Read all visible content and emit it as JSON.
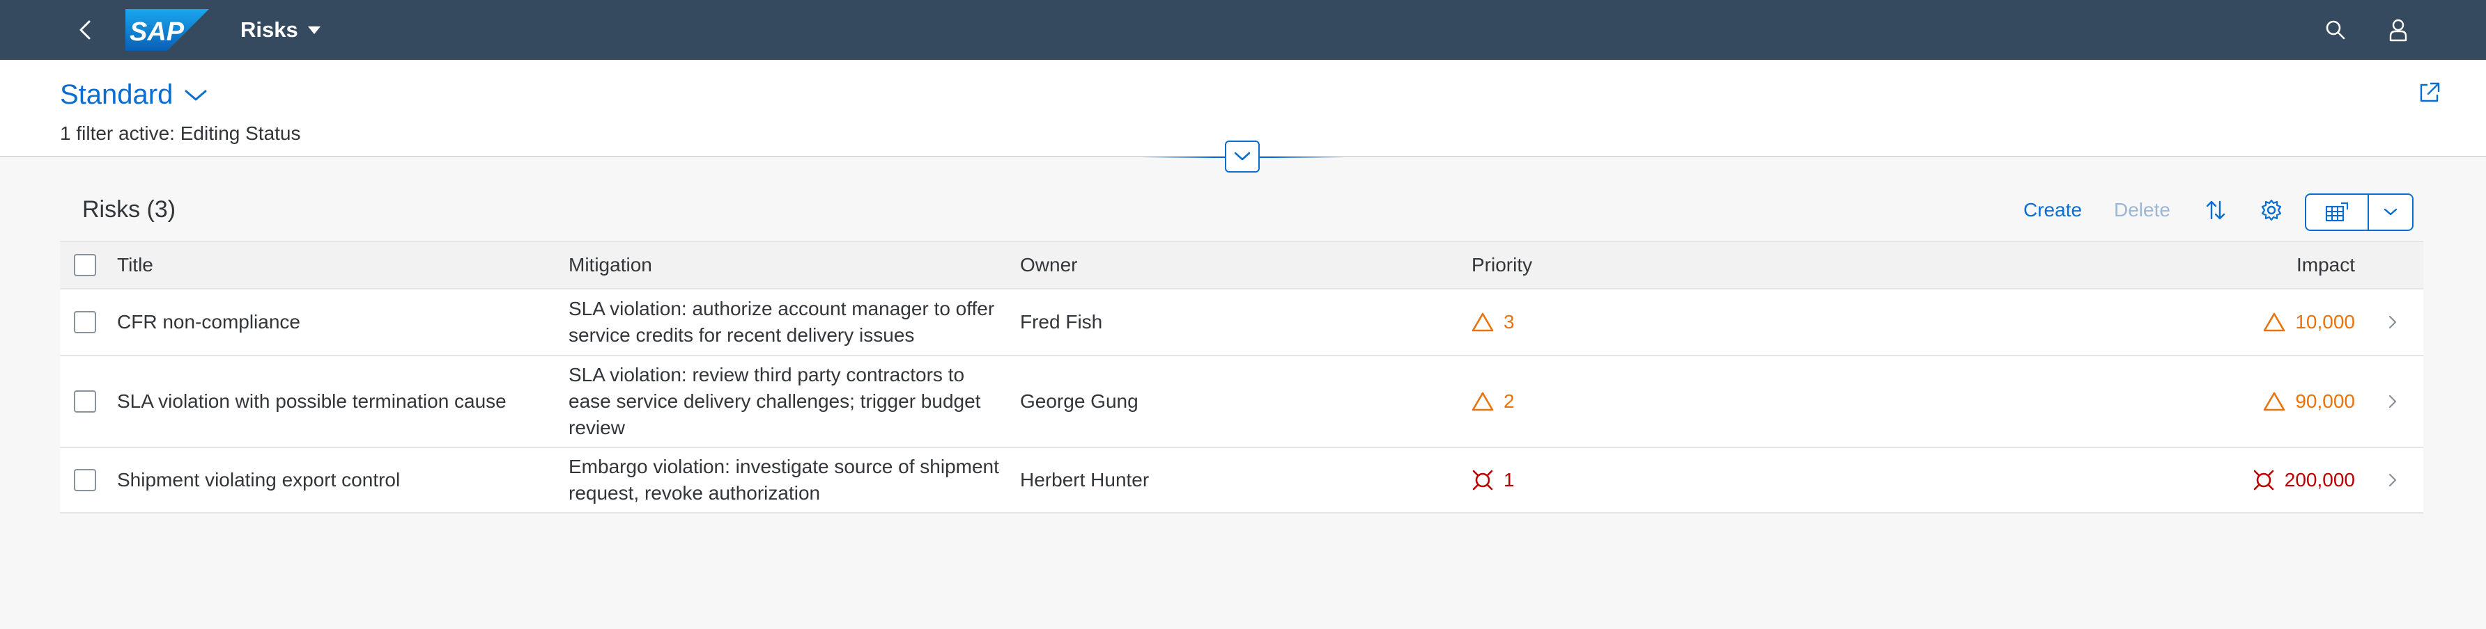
{
  "shell": {
    "logo_text": "SAP",
    "app_title": "Risks",
    "icons": [
      "back-icon",
      "search-icon",
      "user-icon"
    ]
  },
  "header": {
    "variant": "Standard",
    "filter_info": "1 filter active: Editing Status"
  },
  "toolbar": {
    "title": "Risks (3)",
    "create_label": "Create",
    "delete_label": "Delete",
    "icons": [
      "sort-icon",
      "settings-icon",
      "export-icon",
      "chevron-down-icon"
    ]
  },
  "table": {
    "columns": [
      "Title",
      "Mitigation",
      "Owner",
      "Priority",
      "Impact"
    ],
    "rows": [
      {
        "title": "CFR non-compliance",
        "mitigation": "SLA violation: authorize account manager to offer service credits for recent delivery issues",
        "owner": "Fred Fish",
        "priority": "3",
        "priority_state": "warning",
        "impact": "10,000",
        "impact_state": "warning"
      },
      {
        "title": "SLA violation with possible termination cause",
        "mitigation": "SLA violation: review third party contractors to ease service delivery challenges; trigger budget review",
        "owner": "George Gung",
        "priority": "2",
        "priority_state": "warning",
        "impact": "90,000",
        "impact_state": "warning"
      },
      {
        "title": "Shipment violating export control",
        "mitigation": "Embargo violation: investigate source of shipment request, revoke authorization",
        "owner": "Herbert Hunter",
        "priority": "1",
        "priority_state": "error",
        "impact": "200,000",
        "impact_state": "error"
      }
    ]
  },
  "colors": {
    "shell_bg": "#354a5f",
    "accent": "#0a6ed1",
    "warning": "#e9730c",
    "error": "#bb0000"
  }
}
